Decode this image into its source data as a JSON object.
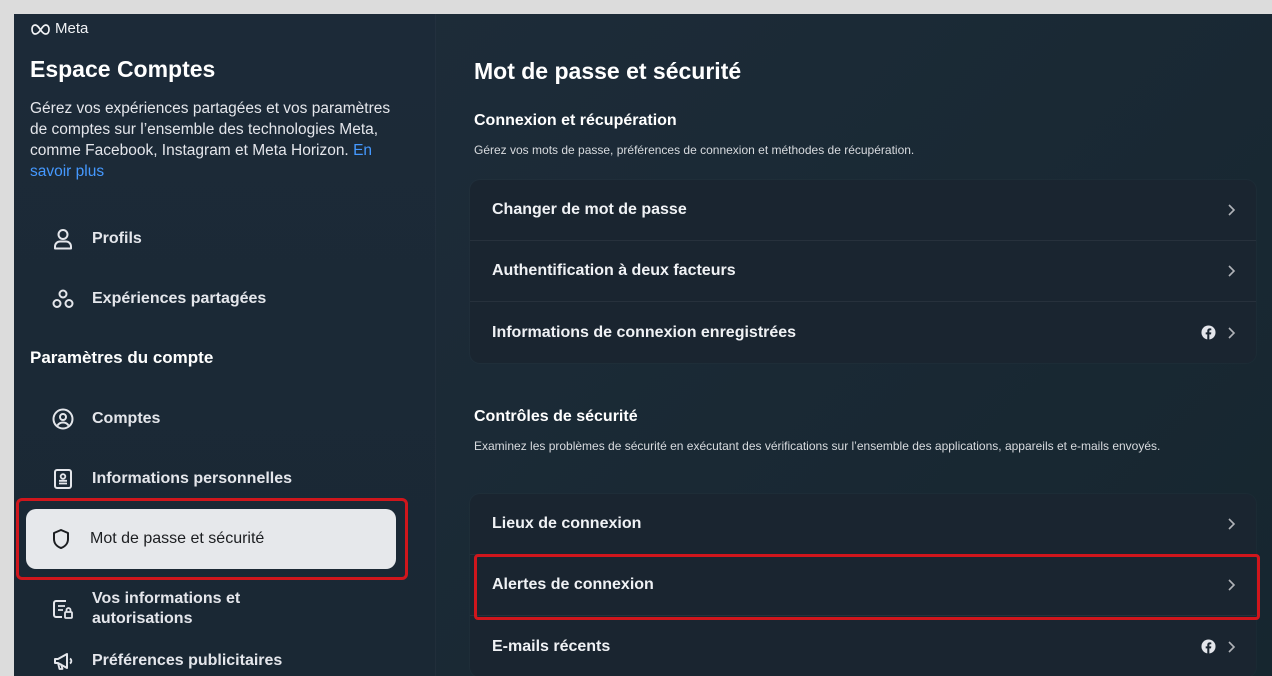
{
  "brand": {
    "logo_text": "Meta"
  },
  "sidebar": {
    "title": "Espace Comptes",
    "description": "Gérez vos expériences partagées et vos paramètres de comptes sur l’ensemble des technologies Meta, comme Facebook, Instagram et Meta Horizon.",
    "learn_more": "En savoir plus",
    "items": [
      {
        "label": "Profils",
        "icon": "person-icon"
      },
      {
        "label": "Expériences partagées",
        "icon": "shared-experiences-icon"
      }
    ],
    "section_label": "Paramètres du compte",
    "account_items": [
      {
        "label": "Comptes",
        "icon": "account-circle-icon"
      },
      {
        "label": "Informations personnelles",
        "icon": "id-card-icon"
      },
      {
        "label": "Mot de passe et sécurité",
        "icon": "shield-icon",
        "active": true
      },
      {
        "label": "Vos informations et autorisations",
        "icon": "info-permissions-icon"
      },
      {
        "label": "Préférences publicitaires",
        "icon": "megaphone-icon"
      }
    ]
  },
  "main": {
    "title": "Mot de passe et sécurité",
    "group1": {
      "title": "Connexion et récupération",
      "description": "Gérez vos mots de passe, préférences de connexion et méthodes de récupération.",
      "rows": [
        {
          "label": "Changer de mot de passe"
        },
        {
          "label": "Authentification à deux facteurs"
        },
        {
          "label": "Informations de connexion enregistrées",
          "facebook_icon": true
        }
      ]
    },
    "group2": {
      "title": "Contrôles de sécurité",
      "description": "Examinez les problèmes de sécurité en exécutant des vérifications sur l’ensemble des applications, appareils et e-mails envoyés.",
      "rows": [
        {
          "label": "Lieux de connexion"
        },
        {
          "label": "Alertes de connexion",
          "highlighted": true
        },
        {
          "label": "E-mails récents",
          "facebook_icon": true
        }
      ]
    }
  },
  "colors": {
    "background": "#1c2a38",
    "accent_link": "#4599ff",
    "active_item_bg": "#e6e8eb",
    "highlight_border": "#d0161c"
  }
}
